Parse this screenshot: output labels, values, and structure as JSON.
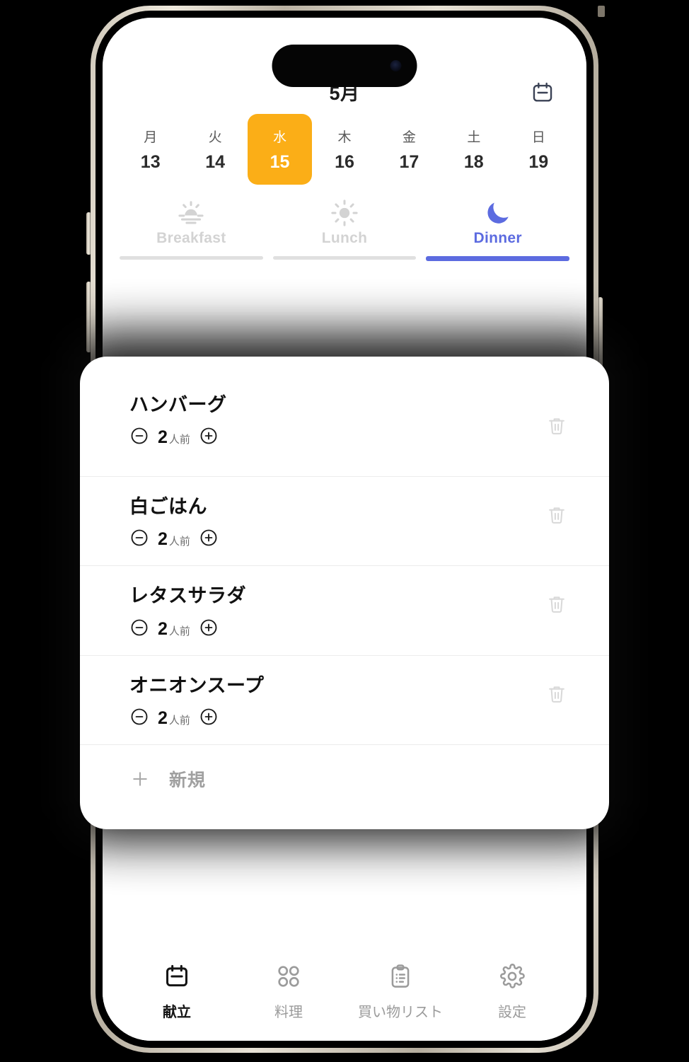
{
  "device": {
    "frame": "iphone-titanium",
    "island": "dynamic-island",
    "camera": "front-camera-dot"
  },
  "header": {
    "month_title": "5月",
    "calendar_icon": "calendar-icon"
  },
  "week": {
    "days": [
      {
        "dow": "月",
        "date": "13",
        "selected": false
      },
      {
        "dow": "火",
        "date": "14",
        "selected": false
      },
      {
        "dow": "水",
        "date": "15",
        "selected": true
      },
      {
        "dow": "木",
        "date": "16",
        "selected": false
      },
      {
        "dow": "金",
        "date": "17",
        "selected": false
      },
      {
        "dow": "土",
        "date": "18",
        "selected": false
      },
      {
        "dow": "日",
        "date": "19",
        "selected": false
      }
    ],
    "selected_color": "#FBAE17"
  },
  "meal_tabs": {
    "accent_color": "#5C6BE0",
    "inactive_color": "#D3D3D3",
    "items": [
      {
        "label": "Breakfast",
        "icon": "sunrise-icon",
        "active": false
      },
      {
        "label": "Lunch",
        "icon": "sun-icon",
        "active": false
      },
      {
        "label": "Dinner",
        "icon": "moon-icon",
        "active": true
      }
    ]
  },
  "card": {
    "dishes": [
      {
        "name": "ハンバーグ",
        "qty": "2",
        "unit": "人前",
        "minus_icon": "circle-minus-icon",
        "plus_icon": "circle-plus-icon",
        "delete_icon": "trash-icon"
      },
      {
        "name": "白ごはん",
        "qty": "2",
        "unit": "人前",
        "minus_icon": "circle-minus-icon",
        "plus_icon": "circle-plus-icon",
        "delete_icon": "trash-icon"
      },
      {
        "name": "レタスサラダ",
        "qty": "2",
        "unit": "人前",
        "minus_icon": "circle-minus-icon",
        "plus_icon": "circle-plus-icon",
        "delete_icon": "trash-icon"
      },
      {
        "name": "オニオンスープ",
        "qty": "2",
        "unit": "人前",
        "minus_icon": "circle-minus-icon",
        "plus_icon": "circle-plus-icon",
        "delete_icon": "trash-icon"
      }
    ],
    "new_row": {
      "label": "新規",
      "icon": "plus-icon"
    }
  },
  "tabbar": {
    "items": [
      {
        "label": "献立",
        "icon": "calendar-icon",
        "active": true
      },
      {
        "label": "料理",
        "icon": "grid-icon",
        "active": false
      },
      {
        "label": "買い物リスト",
        "icon": "clipboard-list-icon",
        "active": false
      },
      {
        "label": "設定",
        "icon": "gear-icon",
        "active": false
      }
    ]
  }
}
